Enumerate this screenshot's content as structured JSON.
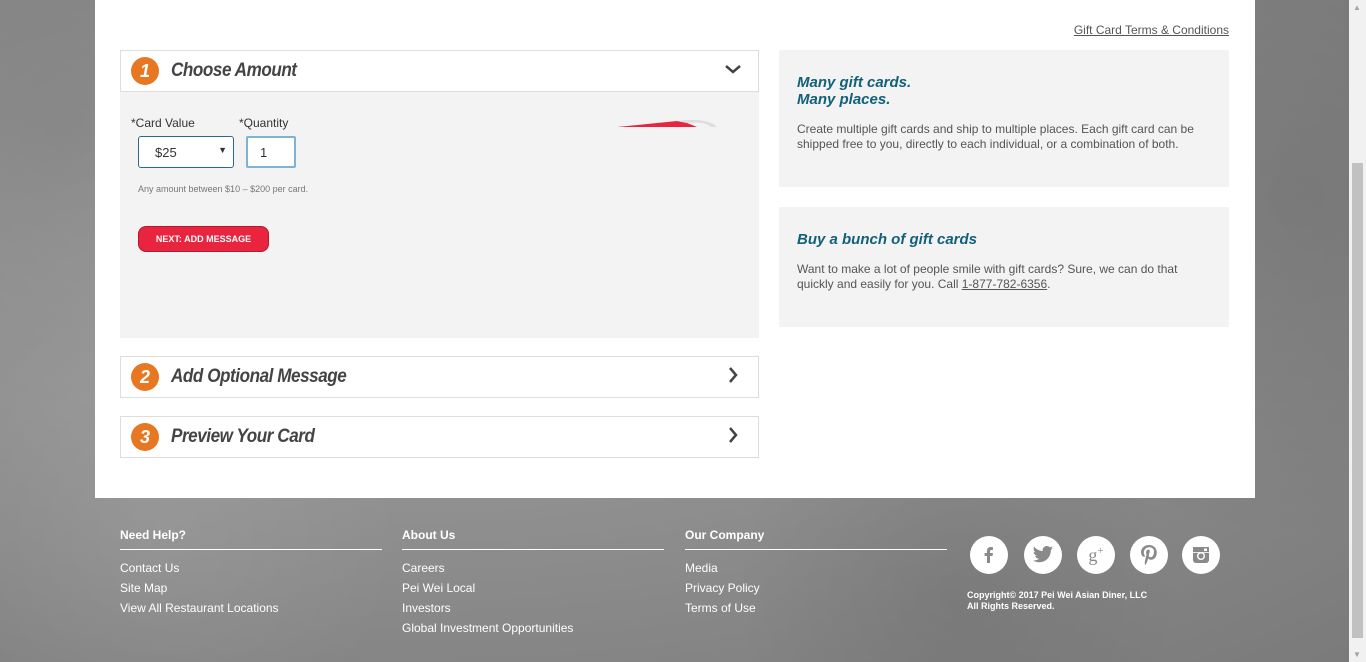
{
  "header": {
    "terms_link": "Gift Card Terms & Conditions"
  },
  "steps": [
    {
      "num": "1",
      "title": "Choose Amount"
    },
    {
      "num": "2",
      "title": "Add Optional Message"
    },
    {
      "num": "3",
      "title": "Preview Your Card"
    }
  ],
  "amount_form": {
    "card_value_label": "*Card Value",
    "quantity_label": "*Quantity",
    "card_value": "$25",
    "quantity": "1",
    "hint": "Any amount between $10 – $200 per card.",
    "next_button": "NEXT: ADD MESSAGE"
  },
  "info": [
    {
      "title_line1": "Many gift cards.",
      "title_line2": "Many places.",
      "text": "Create multiple gift cards and ship to multiple places. Each gift card can be shipped free to you, directly to each individual, or a combination of both."
    },
    {
      "title": "Buy a bunch of gift cards",
      "text_before": "Want to make a lot of people smile with gift cards? Sure, we can do that quickly and easily for you. Call ",
      "phone": "1-877-782-6356",
      "text_after": "."
    }
  ],
  "footer": {
    "need_help": {
      "title": "Need Help?",
      "links": [
        "Contact Us",
        "Site Map",
        "View All Restaurant Locations"
      ]
    },
    "about_us": {
      "title": "About Us",
      "links": [
        "Careers",
        "Pei Wei Local",
        "Investors",
        "Global Investment Opportunities"
      ]
    },
    "our_company": {
      "title": "Our Company",
      "links": [
        "Media",
        "Privacy Policy",
        "Terms of Use"
      ]
    },
    "copyright_line1": "Copyright© 2017 Pei Wei Asian Diner, LLC",
    "copyright_line2": "All Rights Reserved."
  },
  "social_icons": [
    "facebook-icon",
    "twitter-icon",
    "google-plus-icon",
    "pinterest-icon",
    "instagram-icon"
  ],
  "colors": {
    "step_orange": "#e87722",
    "button_red": "#e8243f",
    "title_teal": "#12607a"
  }
}
